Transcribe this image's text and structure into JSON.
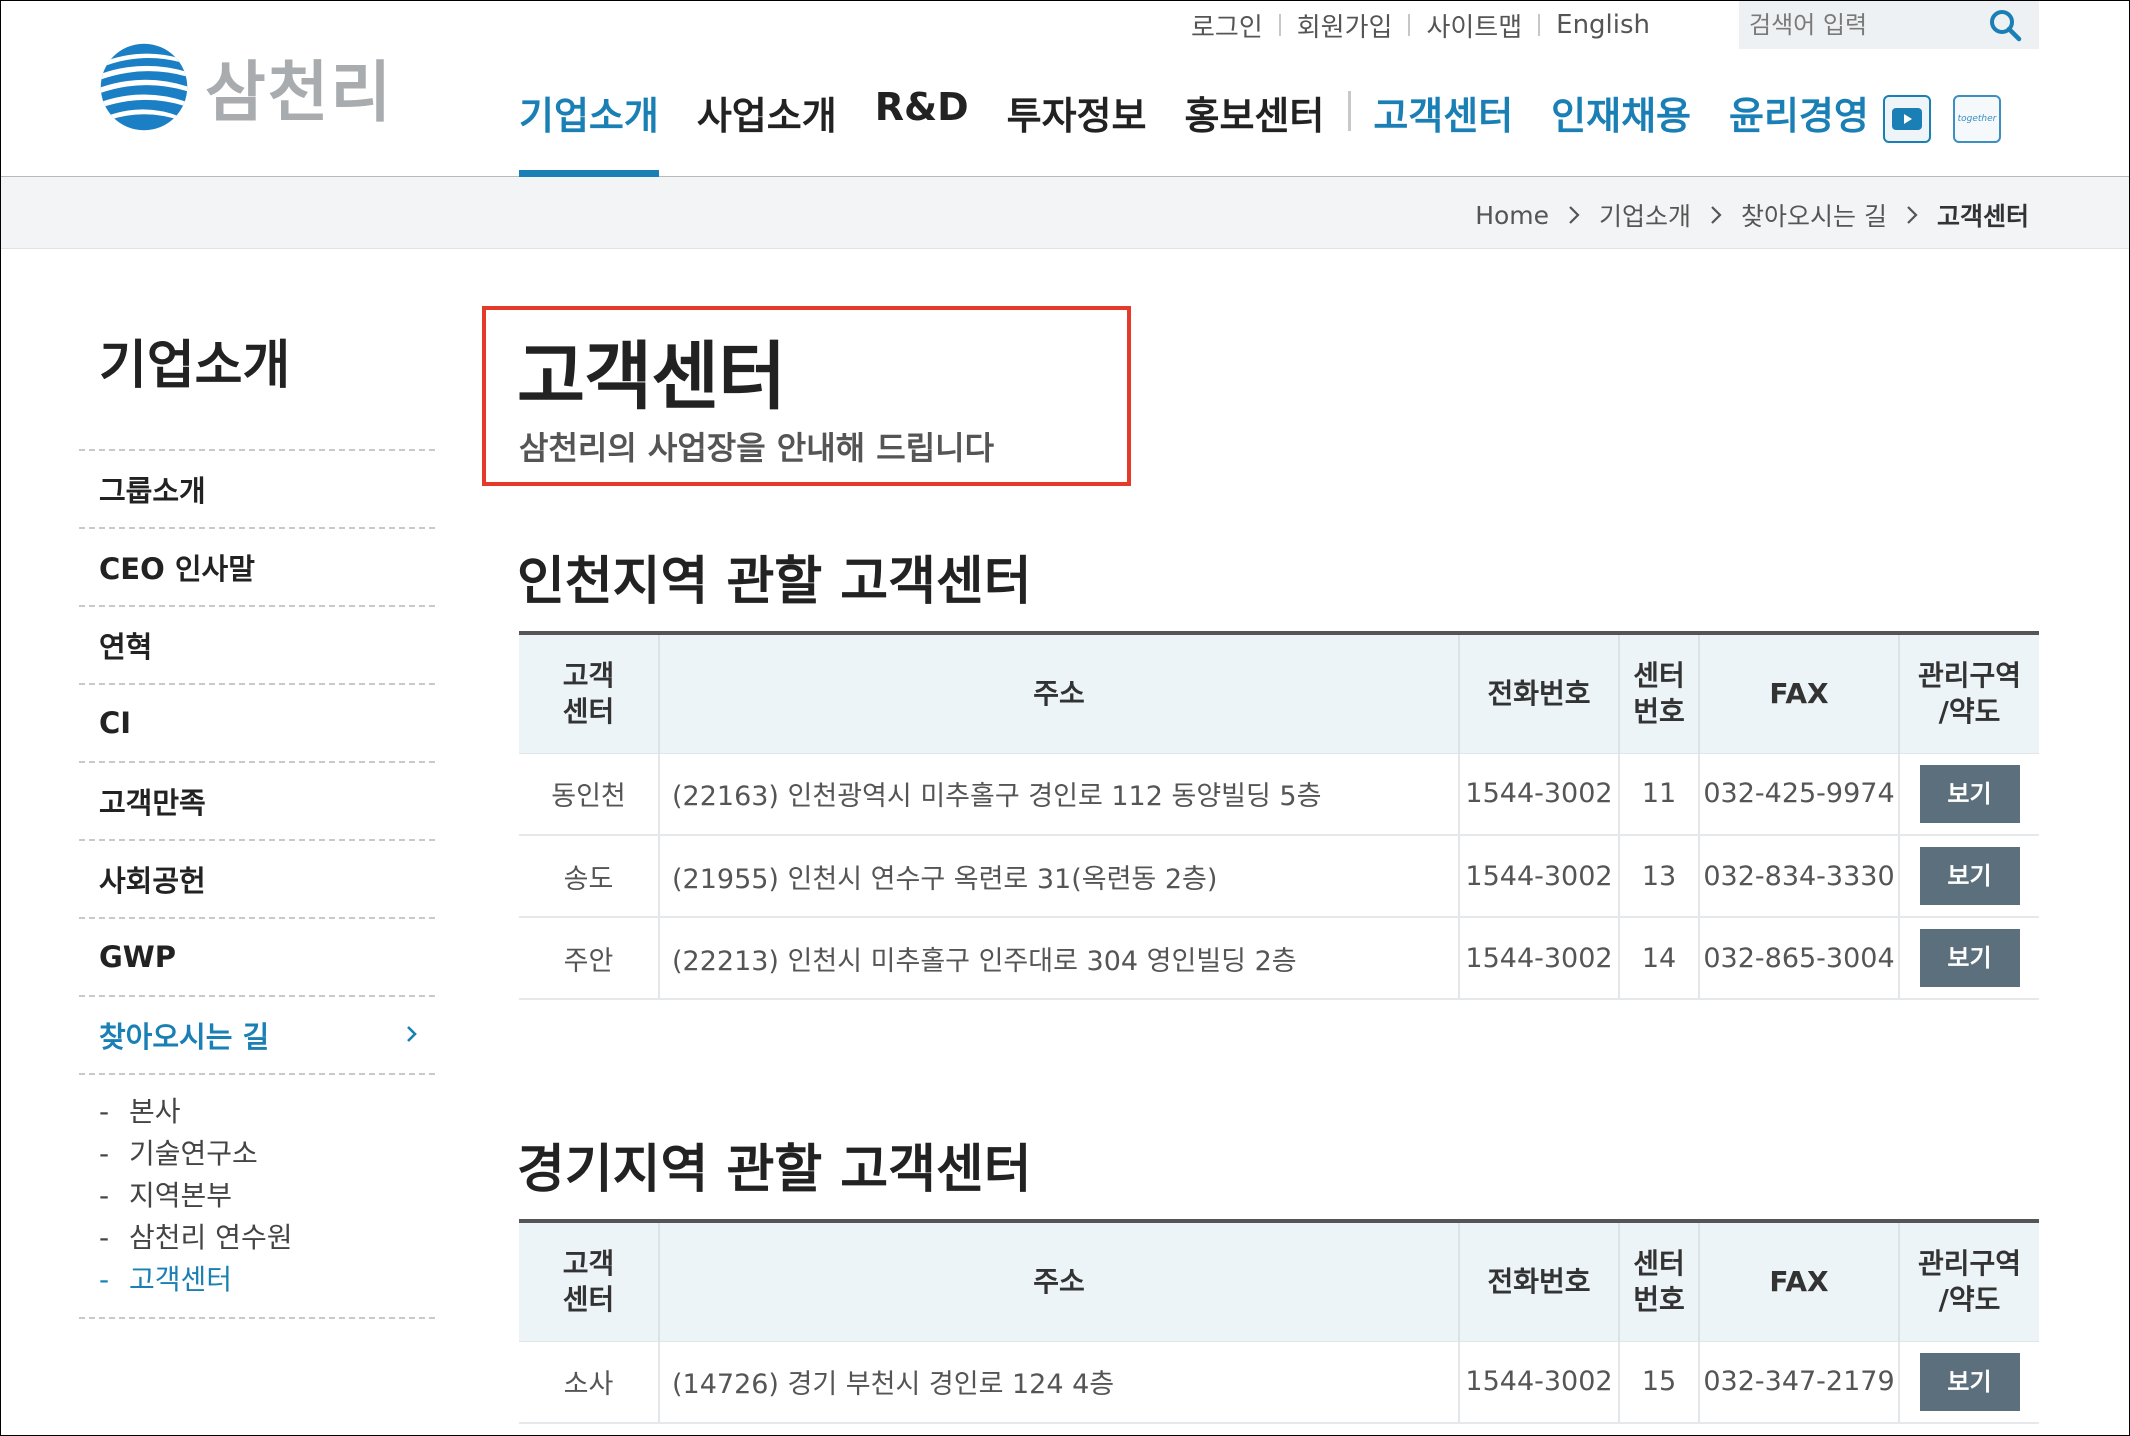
{
  "brand": {
    "logo_text": "삼천리"
  },
  "util_links": [
    "로그인",
    "회원가입",
    "사이트맵",
    "English"
  ],
  "search": {
    "placeholder": "검색어 입력"
  },
  "gnb": [
    "기업소개",
    "사업소개",
    "R&D",
    "투자정보",
    "홍보센터",
    "고객센터",
    "인재채용",
    "윤리경영"
  ],
  "sns": {
    "together_label": "together"
  },
  "breadcrumb": [
    "Home",
    "기업소개",
    "찾아오시는 길",
    "고객센터"
  ],
  "sidebar": {
    "title": "기업소개",
    "items": [
      "그룹소개",
      "CEO 인사말",
      "연혁",
      "CI",
      "고객만족",
      "사회공헌",
      "GWP",
      "찾아오시는 길"
    ],
    "sub_items": [
      "본사",
      "기술연구소",
      "지역본부",
      "삼천리 연수원",
      "고객센터"
    ]
  },
  "page": {
    "title": "고객센터",
    "subtitle": "삼천리의 사업장을 안내해 드립니다"
  },
  "table_headers": {
    "center": [
      "고객",
      "센터"
    ],
    "address": "주소",
    "phone": "전화번호",
    "center_no": [
      "센터",
      "번호"
    ],
    "fax": "FAX",
    "area": [
      "관리구역",
      "/약도"
    ]
  },
  "view_label": "보기",
  "sections": [
    {
      "title": "인천지역 관할 고객센터",
      "rows": [
        {
          "center": "동인천",
          "address": "(22163) 인천광역시 미추홀구 경인로 112 동양빌딩 5층",
          "phone": "1544-3002",
          "no": "11",
          "fax": "032-425-9974"
        },
        {
          "center": "송도",
          "address": "(21955) 인천시 연수구 옥련로 31(옥련동 2층)",
          "phone": "1544-3002",
          "no": "13",
          "fax": "032-834-3330"
        },
        {
          "center": "주안",
          "address": "(22213) 인천시 미추홀구 인주대로 304 영인빌딩 2층",
          "phone": "1544-3002",
          "no": "14",
          "fax": "032-865-3004"
        }
      ]
    },
    {
      "title": "경기지역 관할 고객센터",
      "rows": [
        {
          "center": "소사",
          "address": "(14726) 경기 부천시 경인로 124 4층",
          "phone": "1544-3002",
          "no": "15",
          "fax": "032-347-2179"
        }
      ]
    }
  ]
}
